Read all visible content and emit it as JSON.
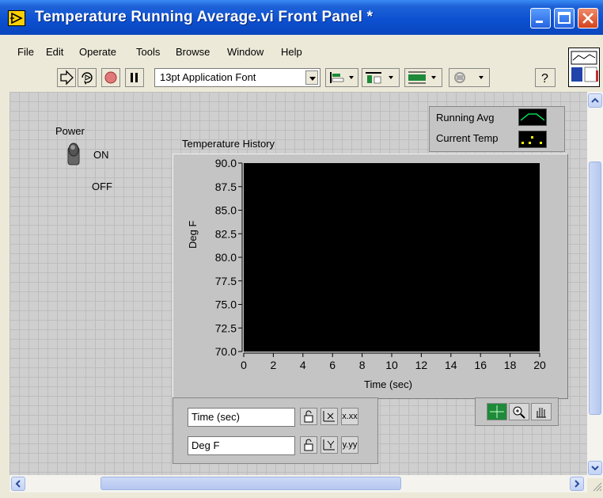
{
  "window": {
    "title": "Temperature Running Average.vi Front Panel *"
  },
  "menu": {
    "file": "File",
    "edit": "Edit",
    "operate": "Operate",
    "tools": "Tools",
    "browse": "Browse",
    "window": "Window",
    "help": "Help"
  },
  "toolbar": {
    "font": "13pt Application Font",
    "help_glyph": "?"
  },
  "power": {
    "label": "Power",
    "on": "ON",
    "off": "OFF"
  },
  "graph": {
    "title": "Temperature History",
    "xlabel": "Time (sec)",
    "ylabel": "Deg F",
    "yticks": [
      "90.0",
      "87.5",
      "85.0",
      "82.5",
      "80.0",
      "77.5",
      "75.0",
      "72.5",
      "70.0"
    ],
    "xticks": [
      "0",
      "2",
      "4",
      "6",
      "8",
      "10",
      "12",
      "14",
      "16",
      "18",
      "20"
    ]
  },
  "legend": {
    "items": [
      {
        "name": "Running Avg",
        "color": "#00ff66"
      },
      {
        "name": "Current Temp",
        "color": "#ffff00"
      }
    ]
  },
  "scale_legend": {
    "x_name": "Time (sec)",
    "y_name": "Deg F",
    "x_format": "x.xx",
    "y_format": "y.yy"
  },
  "colors": {
    "plot_bg": "#000000",
    "panel_grid": "#cfcfcf",
    "titlebar": "#0b4fd0"
  }
}
